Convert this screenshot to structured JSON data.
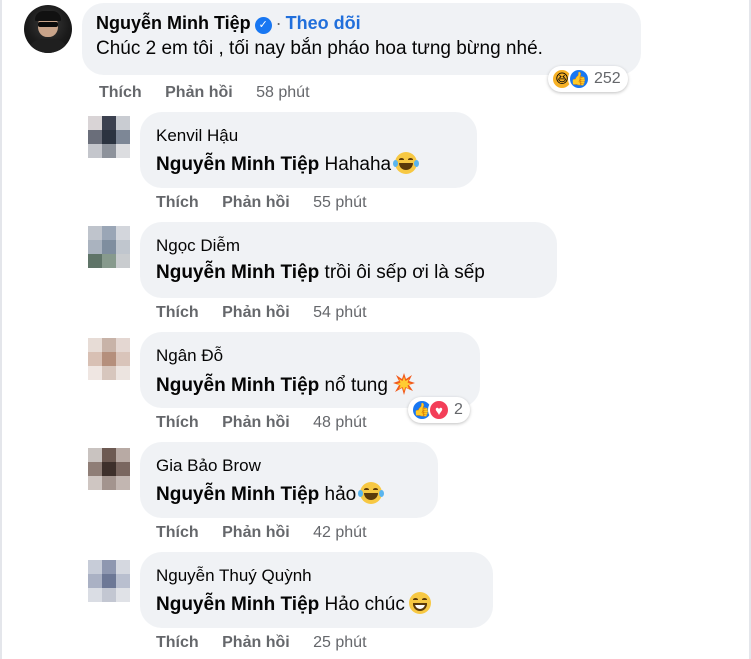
{
  "main_comment": {
    "author": "Nguyễn Minh Tiệp",
    "separator": "·",
    "follow_label": "Theo dõi",
    "text": "Chúc 2 em tôi , tối nay bắn pháo hoa tưng bừng nhé.",
    "reaction_count": "252",
    "like_label": "Thích",
    "reply_label": "Phản hồi",
    "time": "58 phút"
  },
  "replies": [
    {
      "author": "Kenvil Hậu",
      "mention": "Nguyễn Minh Tiệp",
      "text": "Hahaha",
      "emoji": "laughing-tears-emoji",
      "like_label": "Thích",
      "reply_label": "Phản hồi",
      "time": "55 phút",
      "avatar_colors": [
        "#d9d4d6",
        "#3c4150",
        "#c9ccd2",
        "#6a6e7a",
        "#2b3340",
        "#7d8796",
        "#c4c6cc",
        "#8d929b",
        "#dcdde0"
      ]
    },
    {
      "author": "Ngọc Diễm",
      "mention": "Nguyễn Minh Tiệp",
      "text": "trồi ôi sếp ơi là sếp",
      "like_label": "Thích",
      "reply_label": "Phản hồi",
      "time": "54 phút",
      "avatar_colors": [
        "#bfc4cc",
        "#9aa6b6",
        "#d3d6dc",
        "#aab3bf",
        "#7f8e9f",
        "#c0c6ce",
        "#5f7468",
        "#879a8d",
        "#c9cccf"
      ]
    },
    {
      "author": "Ngân Đỗ",
      "mention": "Nguyễn Minh Tiệp",
      "text": "nổ tung",
      "emoji": "explosion-emoji",
      "reaction_count": "2",
      "like_label": "Thích",
      "reply_label": "Phản hồi",
      "time": "48 phút",
      "avatar_colors": [
        "#e7dcd6",
        "#c8b3a8",
        "#e4d7d2",
        "#d8c0b4",
        "#b58f7c",
        "#d9c4ba",
        "#efe6e2",
        "#d7c6bd",
        "#ece4e0"
      ]
    },
    {
      "author": "Gia Bảo Brow",
      "mention": "Nguyễn Minh Tiệp",
      "text": "hảo",
      "emoji": "laughing-tears-emoji",
      "like_label": "Thích",
      "reply_label": "Phản hồi",
      "time": "42 phút",
      "avatar_colors": [
        "#c9c3c0",
        "#6d5a52",
        "#b8aaa4",
        "#8f7e77",
        "#3e302b",
        "#7a6760",
        "#cfc6c2",
        "#a3948e",
        "#c2b6b1"
      ]
    },
    {
      "author": "Nguyễn Thuý Quỳnh",
      "mention": "Nguyễn Minh Tiệp",
      "text": "Hảo chúc",
      "emoji": "grinning-emoji",
      "like_label": "Thích",
      "reply_label": "Phản hồi",
      "time": "25 phút",
      "avatar_colors": [
        "#c7ccd8",
        "#8e97b0",
        "#d5d8e0",
        "#aab1c4",
        "#6d7896",
        "#b9bfcf",
        "#dadde4",
        "#c3c7d2",
        "#e0e2e7"
      ]
    }
  ]
}
